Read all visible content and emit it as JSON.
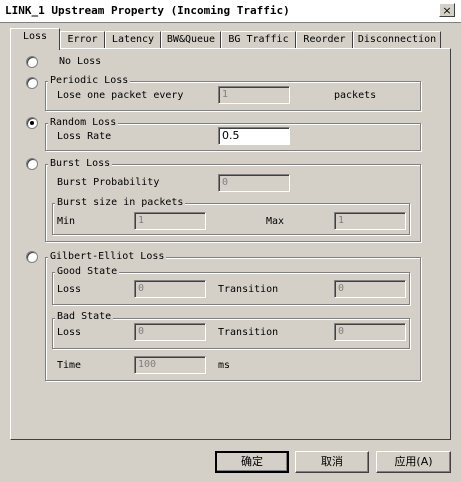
{
  "window": {
    "title": "LINK_1 Upstream Property (Incoming Traffic)",
    "close_label": "×"
  },
  "tabs": [
    {
      "label": "Loss",
      "active": true
    },
    {
      "label": "Error"
    },
    {
      "label": "Latency"
    },
    {
      "label": "BW&Queue"
    },
    {
      "label": "BG  Traffic"
    },
    {
      "label": "Reorder"
    },
    {
      "label": "Disconnection"
    }
  ],
  "no_loss": {
    "label": "No Loss",
    "checked": false
  },
  "periodic_loss": {
    "label": "Periodic Loss",
    "checked": false,
    "field_label": "Lose one packet every",
    "value": "1",
    "unit": "packets"
  },
  "random_loss": {
    "label": "Random Loss",
    "checked": true,
    "field_label": "Loss Rate",
    "value": "0.5"
  },
  "burst_loss": {
    "label": "Burst Loss",
    "checked": false,
    "probability_label": "Burst Probability",
    "probability_value": "0",
    "size_group": "Burst size in packets",
    "min_label": "Min",
    "min_value": "1",
    "max_label": "Max",
    "max_value": "1"
  },
  "gilbert_elliot": {
    "label": "Gilbert-Elliot Loss",
    "checked": false,
    "good_state": {
      "title": "Good State",
      "loss_label": "Loss",
      "loss_value": "0",
      "transition_label": "Transition",
      "transition_value": "0"
    },
    "bad_state": {
      "title": "Bad State",
      "loss_label": "Loss",
      "loss_value": "0",
      "transition_label": "Transition",
      "transition_value": "0"
    },
    "time_label": "Time",
    "time_value": "100",
    "time_unit": "ms"
  },
  "buttons": {
    "ok": "确定",
    "cancel": "取消",
    "apply": "应用(A)"
  }
}
